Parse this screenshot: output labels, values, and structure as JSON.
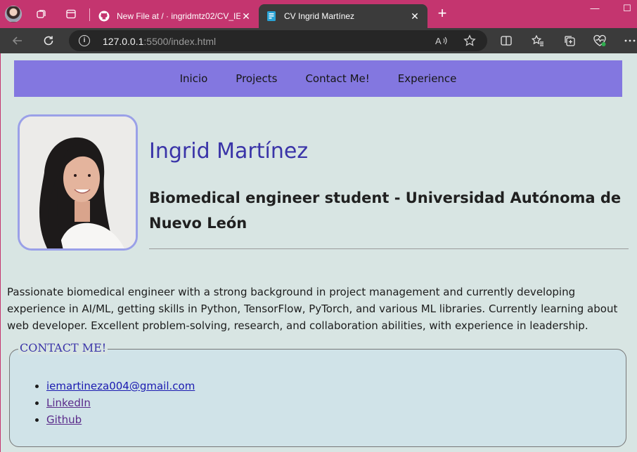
{
  "browser": {
    "tabs": [
      {
        "title": "New File at / · ingridmtz02/CV_IE",
        "active": false,
        "favicon": "github-icon"
      },
      {
        "title": "CV Ingrid Martínez",
        "active": true,
        "favicon": "vscode-live-icon"
      }
    ],
    "url": {
      "host": "127.0.0.1",
      "rest": ":5500/index.html"
    }
  },
  "page": {
    "nav": [
      "Inicio",
      "Projects",
      "Contact Me!",
      "Experience"
    ],
    "name": "Ingrid Martínez",
    "subtitle": "Biomedical engineer student - Universidad Autónoma de Nuevo León",
    "bio": "Passionate biomedical engineer with a strong background in project management and currently developing experience in AI/ML, getting skills in Python, TensorFlow, PyTorch, and various ML libraries. Currently learning about web developer. Excellent problem-solving, research, and collaboration abilities, with experience in leadership.",
    "contact": {
      "legend": "CONTACT ME!",
      "links": [
        "iemartineza004@gmail.com",
        "LinkedIn",
        "Github"
      ]
    }
  },
  "colors": {
    "tabstrip": "#c4356f",
    "navbar": "#8377e0",
    "accent": "#3a34a8",
    "page_bg": "#d8e5e3"
  }
}
